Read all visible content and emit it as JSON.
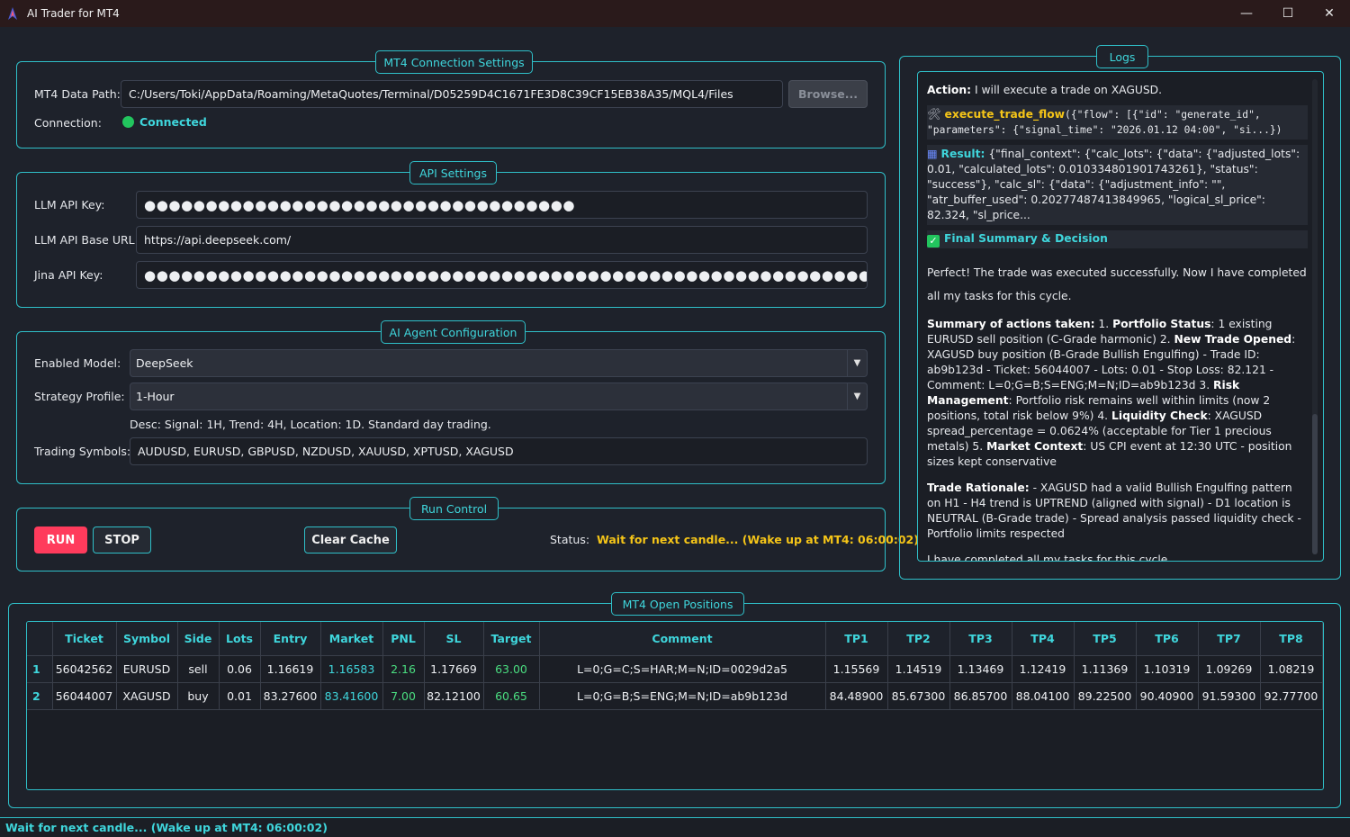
{
  "window": {
    "title": "AI Trader for MT4",
    "minimize": "—",
    "maximize": "☐",
    "close": "✕"
  },
  "connection": {
    "group_title": "MT4 Connection Settings",
    "data_path_label": "MT4 Data Path:",
    "data_path_value": "C:/Users/Toki/AppData/Roaming/MetaQuotes/Terminal/D05259D4C1671FE3D8C39CF15EB38A35/MQL4/Files",
    "browse_label": "Browse...",
    "connection_label": "Connection:",
    "connection_status": "Connected",
    "status_color": "#22c55e"
  },
  "api": {
    "group_title": "API Settings",
    "llm_key_label": "LLM API Key:",
    "llm_key_value": "●●●●●●●●●●●●●●●●●●●●●●●●●●●●●●●●●●●",
    "llm_base_label": "LLM API Base URL:",
    "llm_base_value": "https://api.deepseek.com/",
    "jina_key_label": "Jina API Key:",
    "jina_key_value": "●●●●●●●●●●●●●●●●●●●●●●●●●●●●●●●●●●●●●●●●●●●●●●●●●●●●●●●●●●●●●●●●●●●●●"
  },
  "agent": {
    "group_title": "AI Agent Configuration",
    "model_label": "Enabled Model:",
    "model_value": "DeepSeek",
    "strategy_label": "Strategy Profile:",
    "strategy_value": "1-Hour",
    "desc": "Desc: Signal: 1H, Trend: 4H, Location: 1D. Standard day trading.",
    "symbols_label": "Trading Symbols:",
    "symbols_value": "AUDUSD, EURUSD, GBPUSD, NZDUSD, XAUUSD, XPTUSD, XAGUSD"
  },
  "run": {
    "group_title": "Run Control",
    "run_label": "RUN",
    "stop_label": "STOP",
    "clear_label": "Clear Cache",
    "status_label": "Status:",
    "status_value": "Wait for next candle... (Wake up at MT4: 06:00:02)",
    "status_color": "#f5c518"
  },
  "logs": {
    "group_title": "Logs",
    "action_label": "Action:",
    "action_text": " I will execute a trade on XAGUSD.",
    "tool_icon": "🛠",
    "tool_fn": "execute_trade_flow",
    "tool_args": "({\"flow\": [{\"id\": \"generate_id\", \"parameters\": {\"signal_time\": \"2026.01.12 04:00\", \"si...})",
    "result_icon": "▦",
    "result_label": "Result:",
    "result_text": " {\"final_context\": {\"calc_lots\": {\"data\": {\"adjusted_lots\": 0.01, \"calculated_lots\": 0.010334801901743261}, \"status\": \"success\"}, \"calc_sl\": {\"data\": {\"adjustment_info\": \"\", \"atr_buffer_used\": 0.20277487413849965, \"logical_sl_price\": 82.324, \"sl_price...",
    "summary_check": "✓",
    "summary_head": "Final Summary & Decision",
    "p1": "Perfect! The trade was executed successfully. Now I have completed all my tasks for this cycle.",
    "s_h": "Summary of actions taken:",
    "s_1n": " 1. ",
    "s_1b": "Portfolio Status",
    "s_1t": ": 1 existing EURUSD sell position (C-Grade harmonic) 2. ",
    "s_2b": "New Trade Opened",
    "s_2t": ": XAGUSD buy position (B-Grade Bullish Engulfing) - Trade ID: ab9b123d - Ticket: 56044007 - Lots: 0.01 - Stop Loss: 82.121 - Comment: L=0;G=B;S=ENG;M=N;ID=ab9b123d 3. ",
    "s_3b": "Risk Management",
    "s_3t": ": Portfolio risk remains well within limits (now 2 positions, total risk below 9%) 4. ",
    "s_4b": "Liquidity Check",
    "s_4t": ": XAGUSD spread_percentage = 0.0624% (acceptable for Tier 1 precious metals) 5. ",
    "s_5b": "Market Context",
    "s_5t": ": US CPI event at 12:30 UTC - position sizes kept conservative",
    "r_h": "Trade Rationale:",
    "r_t": " - XAGUSD had a valid Bullish Engulfing pattern on H1 - H4 trend is UPTREND (aligned with signal) - D1 location is NEUTRAL (B-Grade trade) - Spread analysis passed liquidity check - Portfolio limits respected",
    "p_end": "I have completed all my tasks for this cycle."
  },
  "positions": {
    "group_title": "MT4 Open Positions",
    "columns": [
      "Ticket",
      "Symbol",
      "Side",
      "Lots",
      "Entry",
      "Market",
      "PNL",
      "SL",
      "Target",
      "Comment",
      "TP1",
      "TP2",
      "TP3",
      "TP4",
      "TP5",
      "TP6",
      "TP7",
      "TP8"
    ],
    "rows": [
      {
        "num": "1",
        "cells": [
          "56042562",
          "EURUSD",
          "sell",
          "0.06",
          "1.16619",
          "1.16583",
          "2.16",
          "1.17669",
          "63.00",
          "L=0;G=C;S=HAR;M=N;ID=0029d2a5",
          "1.15569",
          "1.14519",
          "1.13469",
          "1.12419",
          "1.11369",
          "1.10319",
          "1.09269",
          "1.08219"
        ]
      },
      {
        "num": "2",
        "cells": [
          "56044007",
          "XAGUSD",
          "buy",
          "0.01",
          "83.27600",
          "83.41600",
          "7.00",
          "82.12100",
          "60.65",
          "L=0;G=B;S=ENG;M=N;ID=ab9b123d",
          "84.48900",
          "85.67300",
          "86.85700",
          "88.04100",
          "89.22500",
          "90.40900",
          "91.59300",
          "92.77700"
        ]
      }
    ]
  },
  "statusbar": {
    "text": "Wait for next candle... (Wake up at MT4: 06:00:02)"
  },
  "colors": {
    "accent": "#2fbfc8",
    "accent_text": "#3fd6dc",
    "run_button": "#ff3b5c",
    "pnl_positive": "#4ade80"
  }
}
